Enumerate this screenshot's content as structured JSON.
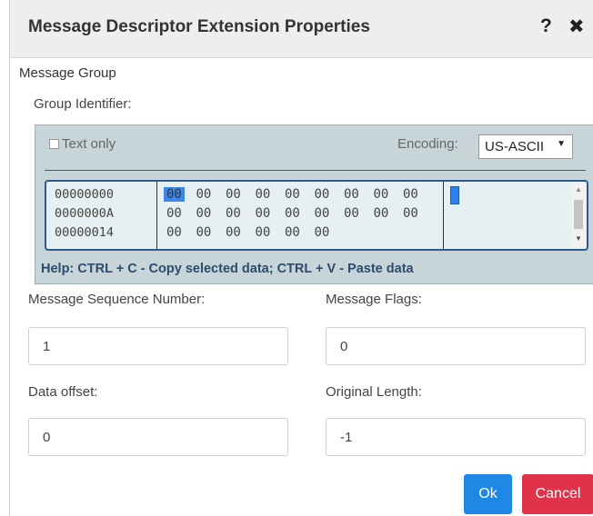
{
  "dialog": {
    "title": "Message Descriptor Extension Properties",
    "help_icon": "?",
    "close_icon": "✖"
  },
  "message_group": {
    "section_title": "Message Group",
    "group_identifier_label": "Group Identifier:",
    "text_only_label": "Text only",
    "text_only_checked": false,
    "encoding_label": "Encoding:",
    "encoding_value": "US-ASCII",
    "hex_rows": [
      {
        "address": "00000000",
        "bytes": [
          "00",
          "00",
          "00",
          "00",
          "00",
          "00",
          "00",
          "00",
          "00"
        ]
      },
      {
        "address": "0000000A",
        "bytes": [
          "00",
          "00",
          "00",
          "00",
          "00",
          "00",
          "00",
          "00",
          "00"
        ]
      },
      {
        "address": "00000014",
        "bytes": [
          "00",
          "00",
          "00",
          "00",
          "00",
          "00"
        ]
      }
    ],
    "help_text": "Help: CTRL + C - Copy selected data; CTRL + V - Paste data"
  },
  "fields": {
    "sequence_number_label": "Message Sequence Number:",
    "sequence_number_value": "1",
    "flags_label": "Message Flags:",
    "flags_value": "0",
    "data_offset_label": "Data offset:",
    "data_offset_value": "0",
    "original_length_label": "Original Length:",
    "original_length_value": "-1"
  },
  "buttons": {
    "ok": "Ok",
    "cancel": "Cancel"
  },
  "colors": {
    "ok": "#1e88e5",
    "cancel": "#e0334a",
    "hex_panel": "#c7d4d8",
    "selection": "#3b86e6"
  }
}
